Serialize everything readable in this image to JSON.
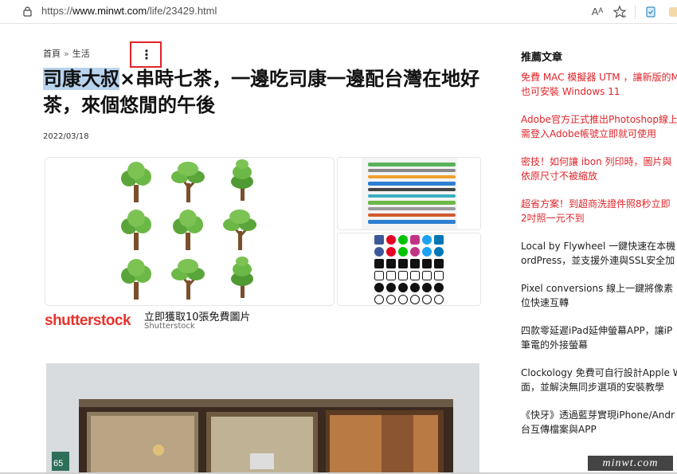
{
  "browser": {
    "url_prefix": "https://",
    "url_domain": "www.minwt.com",
    "url_path": "/life/23429.html",
    "read_aloud_label": "Aᴬ"
  },
  "article": {
    "breadcrumb": [
      "首頁",
      "生活"
    ],
    "breadcrumb_sep": "»",
    "title_highlight": "司康大叔",
    "title_rest": "×串時七茶，一邊吃司康一邊配台灣在地好茶，來個悠閒的午後",
    "date": "2022/03/18",
    "kebab_glyph": "⋮"
  },
  "ad": {
    "brand": "shutterstock",
    "headline": "立即獲取10張免費圖片",
    "advertiser": "Shutterstock"
  },
  "sidebar": {
    "heading": "推薦文章",
    "items": [
      {
        "lines": [
          "免費 MAC 模擬器 UTM ，讓新版的M",
          "也可安裝 Windows 11"
        ],
        "color": "red"
      },
      {
        "lines": [
          "Adobe官方正式推出Photoshop線上",
          "需登入Adobe帳號立即就可使用"
        ],
        "color": "red"
      },
      {
        "lines": [
          "密技！如何讓 ibon 列印時，圖片與",
          "依原尺寸不被縮放"
        ],
        "color": "red"
      },
      {
        "lines": [
          "超省方案！到超商洗證件照8秒立即",
          "2吋照一元不到"
        ],
        "color": "red"
      },
      {
        "lines": [
          "Local by Flywheel 一鍵快速在本機",
          "ordPress，並支援外連與SSL安全加"
        ],
        "color": "dark"
      },
      {
        "lines": [
          "Pixel conversions 線上一鍵將像素",
          "位快速互轉"
        ],
        "color": "dark"
      },
      {
        "lines": [
          "四款零延遲iPad延伸螢幕APP，讓iP",
          "筆電的外接螢幕"
        ],
        "color": "dark"
      },
      {
        "lines": [
          "Clockology 免費可自行設計Apple W",
          "面，並解決無同步選項的安裝教學"
        ],
        "color": "dark"
      },
      {
        "lines": [
          "《快牙》透過藍芽實現iPhone/Andr",
          "台互傳檔案與APP"
        ],
        "color": "dark"
      }
    ]
  },
  "watermark": "minwt.com",
  "colors": {
    "accent_red": "#e0242a",
    "highlight": "#b8d3ee",
    "tree_green": "#5aa53a"
  }
}
